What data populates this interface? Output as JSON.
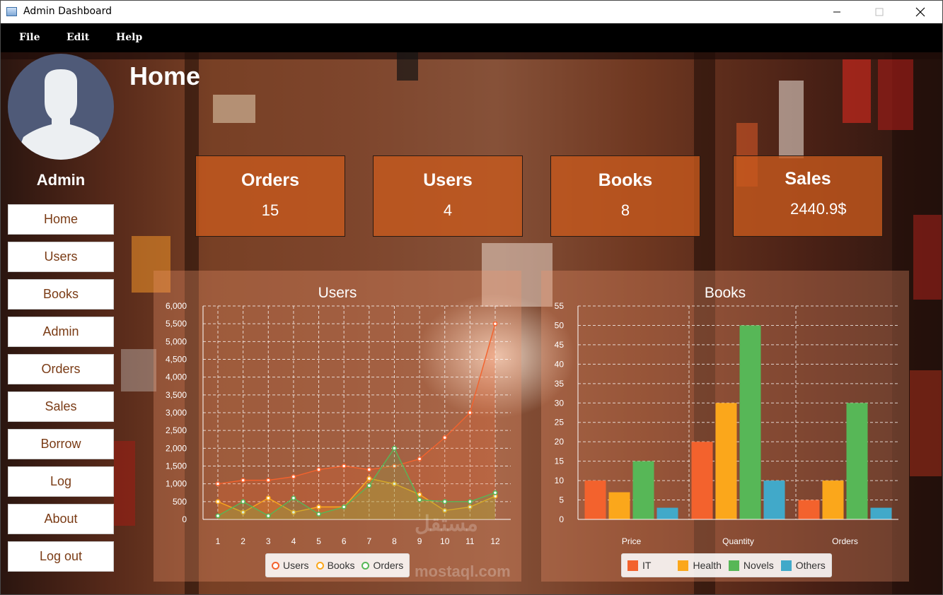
{
  "window": {
    "title": "Admin Dashboard"
  },
  "menubar": {
    "items": [
      "File",
      "Edit",
      "Help"
    ]
  },
  "user": {
    "name": "Admin"
  },
  "nav": {
    "items": [
      "Home",
      "Users",
      "Books",
      "Admin",
      "Orders",
      "Sales",
      "Borrow",
      "Log",
      "About",
      "Log out"
    ]
  },
  "page": {
    "title": "Home"
  },
  "stats": [
    {
      "label": "Orders",
      "value": "15"
    },
    {
      "label": "Users",
      "value": "4"
    },
    {
      "label": "Books",
      "value": "8"
    },
    {
      "label": "Sales",
      "value": "2440.9$"
    }
  ],
  "watermark": {
    "line1": "مستقل",
    "line2": "mostaql.com"
  },
  "chart_data": [
    {
      "type": "area",
      "title": "Users",
      "x": [
        1,
        2,
        3,
        4,
        5,
        6,
        7,
        8,
        9,
        10,
        11,
        12
      ],
      "ylim": [
        0,
        6000
      ],
      "yticks": [
        "0",
        "500",
        "1,000",
        "1,500",
        "2,000",
        "2,500",
        "3,000",
        "3,500",
        "4,000",
        "4,500",
        "5,000",
        "5,500",
        "6,000"
      ],
      "grid": true,
      "legend": "bottom",
      "series": [
        {
          "name": "Users",
          "color": "#f3622d",
          "values": [
            1000,
            1100,
            1100,
            1200,
            1400,
            1500,
            1400,
            1500,
            1700,
            2300,
            3000,
            5500
          ]
        },
        {
          "name": "Books",
          "color": "#fba71b",
          "values": [
            500,
            200,
            600,
            200,
            350,
            350,
            1150,
            1000,
            700,
            250,
            350,
            650
          ]
        },
        {
          "name": "Orders",
          "color": "#57b757",
          "values": [
            100,
            500,
            100,
            600,
            150,
            350,
            950,
            2000,
            550,
            500,
            500,
            750
          ]
        }
      ]
    },
    {
      "type": "bar",
      "title": "Books",
      "categories": [
        "Price",
        "Quantity",
        "Orders"
      ],
      "ylim": [
        0,
        55
      ],
      "yticks": [
        "0",
        "5",
        "10",
        "15",
        "20",
        "25",
        "30",
        "35",
        "40",
        "45",
        "50",
        "55"
      ],
      "grid": true,
      "legend": "bottom",
      "series": [
        {
          "name": "IT",
          "color": "#f3622d",
          "values": [
            10,
            20,
            5
          ]
        },
        {
          "name": "Health",
          "color": "#fba71b",
          "values": [
            7,
            30,
            10
          ]
        },
        {
          "name": "Novels",
          "color": "#57b757",
          "values": [
            15,
            50,
            30
          ]
        },
        {
          "name": "Others",
          "color": "#41a9c9",
          "values": [
            3,
            10,
            3
          ]
        }
      ]
    }
  ]
}
